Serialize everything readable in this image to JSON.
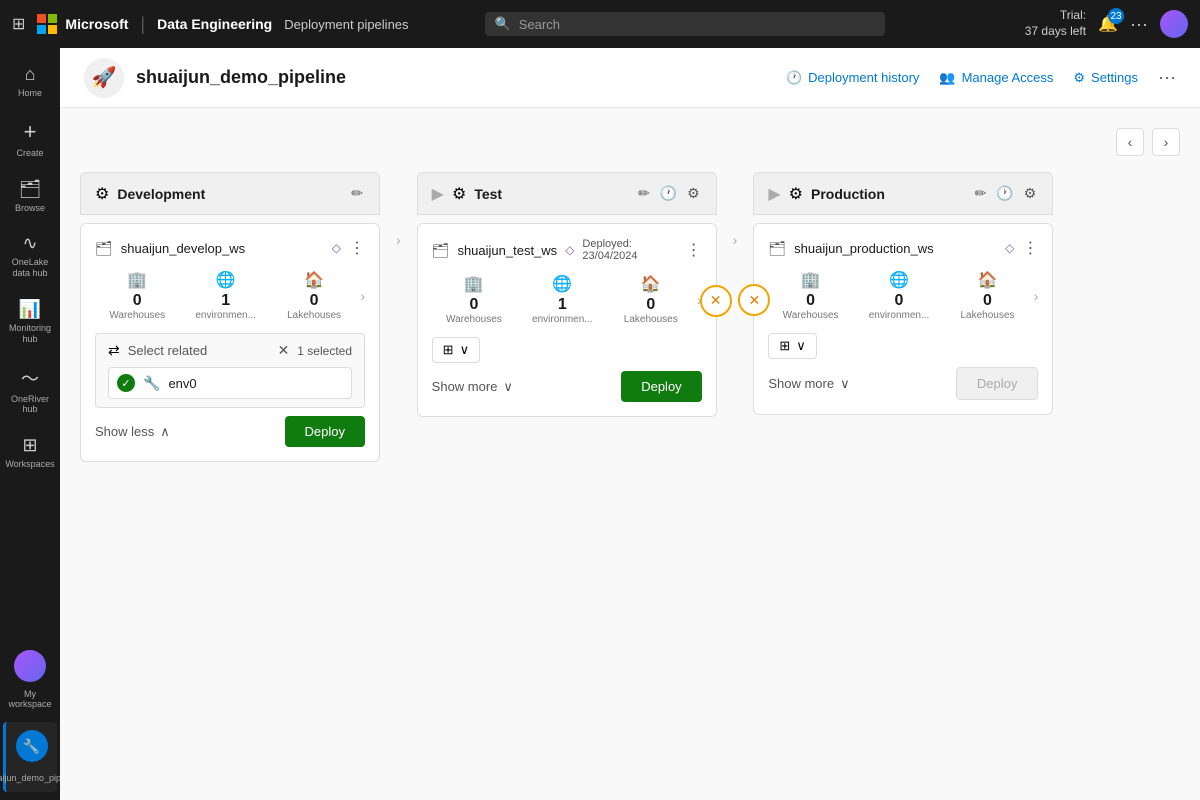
{
  "topbar": {
    "grid_icon": "⊞",
    "brand": "Microsoft",
    "app": "Data Engineering",
    "page": "Deployment pipelines",
    "search_placeholder": "Search",
    "trial_line1": "Trial:",
    "trial_line2": "37 days left",
    "notif_count": "23",
    "more_icon": "···"
  },
  "sidebar": {
    "items": [
      {
        "id": "home",
        "icon": "⌂",
        "label": "Home"
      },
      {
        "id": "create",
        "icon": "+",
        "label": "Create"
      },
      {
        "id": "browse",
        "icon": "📁",
        "label": "Browse"
      },
      {
        "id": "onelake",
        "icon": "∿",
        "label": "OneLake data hub"
      },
      {
        "id": "monitoring",
        "icon": "📊",
        "label": "Monitoring hub"
      },
      {
        "id": "oneriver",
        "icon": "〜",
        "label": "OneRiver hub"
      },
      {
        "id": "workspaces",
        "icon": "⊞",
        "label": "Workspaces"
      }
    ],
    "bottom": {
      "my_workspace_label": "My workspace",
      "active_label": "shuaijun_demo_pipeline"
    }
  },
  "page": {
    "title": "shuaijun_demo_pipeline",
    "pipeline_icon": "🚀",
    "header_actions": {
      "history_label": "Deployment history",
      "access_label": "Manage Access",
      "settings_label": "Settings"
    }
  },
  "stages": {
    "development": {
      "title": "Development",
      "workspace_name": "shuaijun_develop_ws",
      "diamond": "◇",
      "stats": {
        "warehouses": {
          "value": "0",
          "label": "Warehouses"
        },
        "environments": {
          "value": "1",
          "label": "environmen..."
        },
        "lakehouses": {
          "value": "0",
          "label": "Lakehouses"
        }
      },
      "select_related": {
        "title": "Select related",
        "selected_count": "1 selected",
        "item": {
          "name": "env0"
        }
      },
      "show_less": "Show less",
      "deploy_label": "Deploy"
    },
    "test": {
      "title": "Test",
      "workspace_name": "shuaijun_test_ws",
      "diamond": "◇",
      "deployed_info": "Deployed: 23/04/2024",
      "status": "warning",
      "stats": {
        "warehouses": {
          "value": "0",
          "label": "Warehouses"
        },
        "environments": {
          "value": "1",
          "label": "environmen..."
        },
        "lakehouses": {
          "value": "0",
          "label": "Lakehouses"
        }
      },
      "show_more": "Show more",
      "deploy_label": "Deploy"
    },
    "production": {
      "title": "Production",
      "workspace_name": "shuaijun_production_ws",
      "diamond": "◇",
      "status": "warning",
      "stats": {
        "warehouses": {
          "value": "0",
          "label": "Warehouses"
        },
        "environments": {
          "value": "0",
          "label": "environmen..."
        },
        "lakehouses": {
          "value": "0",
          "label": "Lakehouses"
        }
      },
      "show_more": "Show more",
      "deploy_label": "Deploy"
    }
  }
}
